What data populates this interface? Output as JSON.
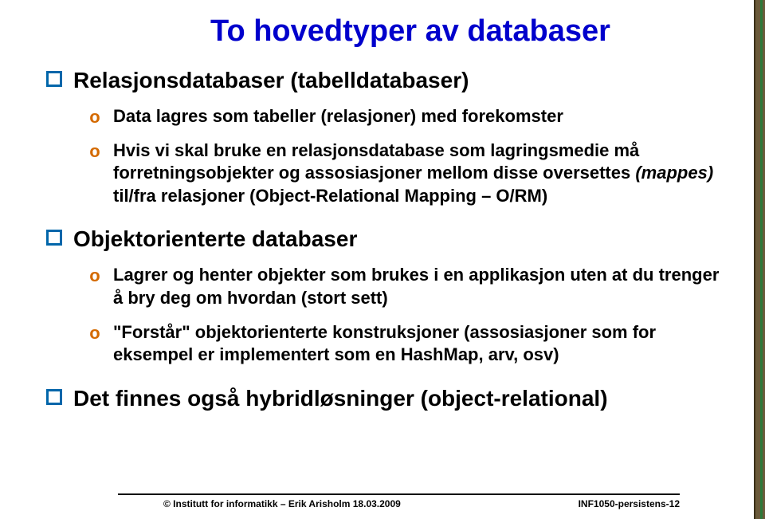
{
  "title": "To hovedtyper av databaser",
  "bullets": {
    "b1": "Relasjonsdatabaser (tabelldatabaser)",
    "b1a": "Data lagres som tabeller (relasjoner) med forekomster",
    "b1b_pre": "Hvis vi skal bruke en relasjonsdatabase som lagringsmedie må forretningsobjekter og assosiasjoner mellom disse oversettes ",
    "b1b_it": "(mappes)",
    "b1b_post": " til/fra relasjoner (Object-Relational Mapping – O/RM)",
    "b2": "Objektorienterte databaser",
    "b2a": "Lagrer og henter objekter som brukes i en applikasjon uten at du trenger å bry deg om hvordan (stort sett)",
    "b2b": "\"Forstår\" objektorienterte konstruksjoner (assosiasjoner som for eksempel er implementert som en HashMap, arv, osv)",
    "b3": "Det finnes også hybridløsninger (object-relational)"
  },
  "footer": {
    "left": "© Institutt for informatikk – Erik Arisholm 18.03.2009",
    "right": "INF1050-persistens-12"
  },
  "circle_glyph": "o"
}
